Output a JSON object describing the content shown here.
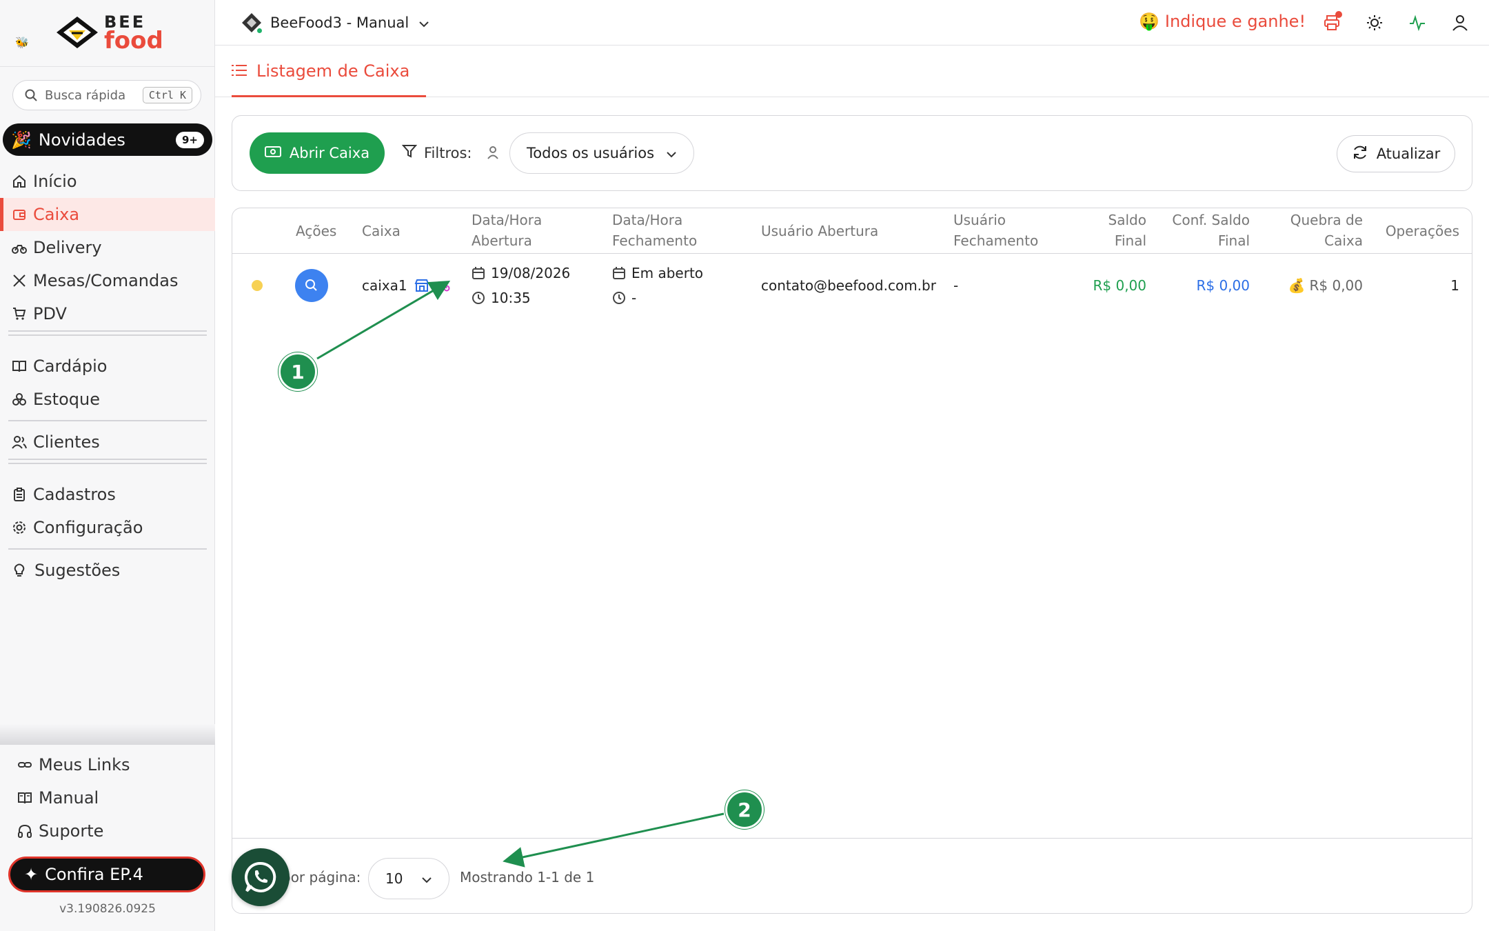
{
  "sidebar": {
    "logo_top": "BEE",
    "logo_bottom": "food",
    "search_placeholder": "Busca rápida",
    "search_shortcut": "Ctrl K",
    "novidades": {
      "label": "Novidades",
      "badge": "9+"
    },
    "items": [
      {
        "label": "Início",
        "icon": "home-icon"
      },
      {
        "label": "Caixa",
        "icon": "wallet-icon",
        "active": true
      },
      {
        "label": "Delivery",
        "icon": "bike-icon"
      },
      {
        "label": "Mesas/Comandas",
        "icon": "utensils-icon"
      },
      {
        "label": "PDV",
        "icon": "cart-icon"
      },
      {
        "label": "Cardápio",
        "icon": "book-icon"
      },
      {
        "label": "Estoque",
        "icon": "boxes-icon"
      },
      {
        "label": "Clientes",
        "icon": "users-icon"
      },
      {
        "label": "Cadastros",
        "icon": "clipboard-icon"
      },
      {
        "label": "Configuração",
        "icon": "gear-icon"
      },
      {
        "label": "Sugestões",
        "icon": "lightbulb-icon"
      }
    ],
    "bottom_items": [
      {
        "label": "Meus Links",
        "icon": "link-icon"
      },
      {
        "label": "Manual",
        "icon": "book-open-icon"
      },
      {
        "label": "Suporte",
        "icon": "headphones-icon"
      }
    ],
    "confira": "Confira EP.4",
    "version": "v3.190826.0925"
  },
  "header": {
    "store_name": "BeeFood3 - Manual",
    "indique": "Indique e ganhe!",
    "indique_emoji": "🤑"
  },
  "page": {
    "tab_title": "Listagem de Caixa"
  },
  "filters": {
    "abrir_caixa": "Abrir Caixa",
    "filtros_label": "Filtros:",
    "users_select": "Todos os usuários",
    "atualizar": "Atualizar"
  },
  "table": {
    "headers": {
      "acoes": "Ações",
      "caixa": "Caixa",
      "abertura_1": "Data/Hora",
      "abertura_2": "Abertura",
      "fechamento_1": "Data/Hora",
      "fechamento_2": "Fechamento",
      "usuario_abertura": "Usuário Abertura",
      "usuario_fech_1": "Usuário",
      "usuario_fech_2": "Fechamento",
      "saldo_1": "Saldo",
      "saldo_2": "Final",
      "conf_1": "Conf. Saldo",
      "conf_2": "Final",
      "quebra_1": "Quebra de",
      "quebra_2": "Caixa",
      "operacoes": "Operações"
    },
    "rows": [
      {
        "caixa": "caixa1",
        "abertura_data": "19/08/2026",
        "abertura_hora": "10:35",
        "fechamento_data": "Em aberto",
        "fechamento_hora": "-",
        "usuario_abertura": "contato@beefood.com.br",
        "usuario_fechamento": "-",
        "saldo_final": "R$ 0,00",
        "conf_saldo_final": "R$ 0,00",
        "quebra_caixa": "R$ 0,00",
        "quebra_emoji": "💰",
        "operacoes": "1"
      }
    ],
    "footer": {
      "per_page_label": "por página:",
      "per_page_value": "10",
      "showing": "Mostrando 1-1 de 1"
    }
  },
  "annotations": {
    "marker_1": "1",
    "marker_2": "2",
    "color": "#1f8f4f"
  },
  "colors": {
    "brand": "#ea4b3c",
    "primary_green": "#1f9f4f",
    "blue": "#2b6ee6"
  }
}
